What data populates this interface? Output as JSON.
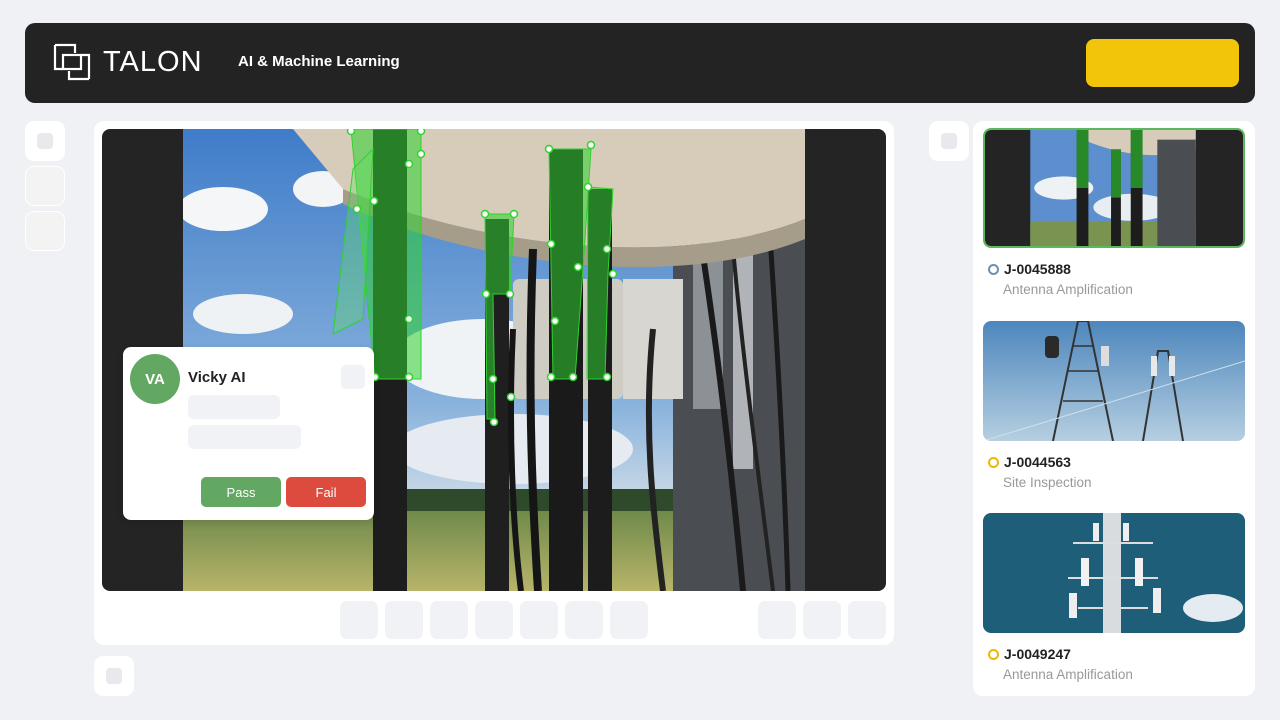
{
  "header": {
    "brand": "TALON",
    "subtitle": "AI & Machine Learning"
  },
  "popup": {
    "avatar_initials": "VA",
    "name": "Vicky AI",
    "pass_label": "Pass",
    "fail_label": "Fail"
  },
  "jobs": [
    {
      "id": "J-0045888",
      "type": "Antenna Amplification",
      "status_color": "#6d8fb3",
      "selected": true
    },
    {
      "id": "J-0044563",
      "type": "Site Inspection",
      "status_color": "#e8b90d",
      "selected": false
    },
    {
      "id": "J-0049247",
      "type": "Antenna Amplification",
      "status_color": "#e8b90d",
      "selected": false
    }
  ],
  "colors": {
    "accent_yellow": "#f2c40a",
    "pass_green": "#62a862",
    "fail_red": "#dd4b3e",
    "annotation_green": "#2fd22f"
  }
}
